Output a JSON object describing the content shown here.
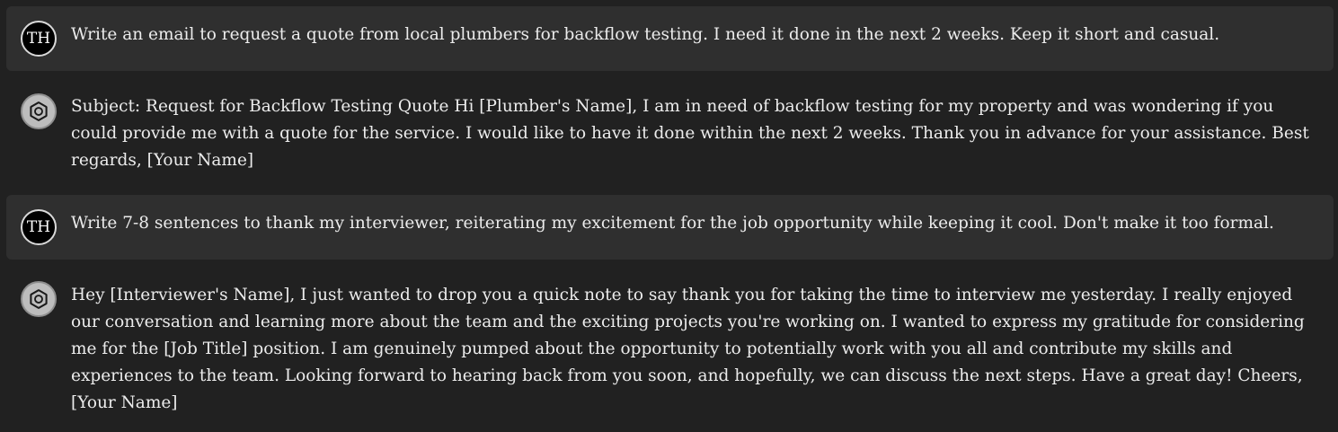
{
  "messages": [
    {
      "role": "user",
      "avatar": "TH",
      "text": "Write an email to request a quote from local plumbers for backflow testing. I need it done in the next 2 weeks. Keep it short and casual."
    },
    {
      "role": "assistant",
      "avatar_icon": "openai-logo-icon",
      "text": "Subject: Request for Backflow Testing Quote Hi [Plumber's Name], I am in need of backflow testing for my property and was wondering if you could provide me with a quote for the service. I would like to have it done within the next 2 weeks. Thank you in advance for your assistance. Best regards, [Your Name]"
    },
    {
      "role": "user",
      "avatar": "TH",
      "text": "Write 7-8 sentences to thank my interviewer, reiterating my excitement for the job opportunity while keeping it cool. Don't make it too formal."
    },
    {
      "role": "assistant",
      "avatar_icon": "openai-logo-icon",
      "text": "Hey [Interviewer's Name], I just wanted to drop you a quick note to say thank you for taking the time to interview me yesterday. I really enjoyed our conversation and learning more about the team and the exciting projects you're working on. I wanted to express my gratitude for considering me for the [Job Title] position. I am genuinely pumped about the opportunity to potentially work with you all and contribute my skills and experiences to the team. Looking forward to hearing back from you soon, and hopefully, we can discuss the next steps. Have a great day! Cheers, [Your Name]"
    }
  ],
  "colors": {
    "background": "#212121",
    "user_message_bg": "#2f2f2f",
    "text": "#ececec",
    "bot_avatar_bg": "#bdbdbd"
  }
}
